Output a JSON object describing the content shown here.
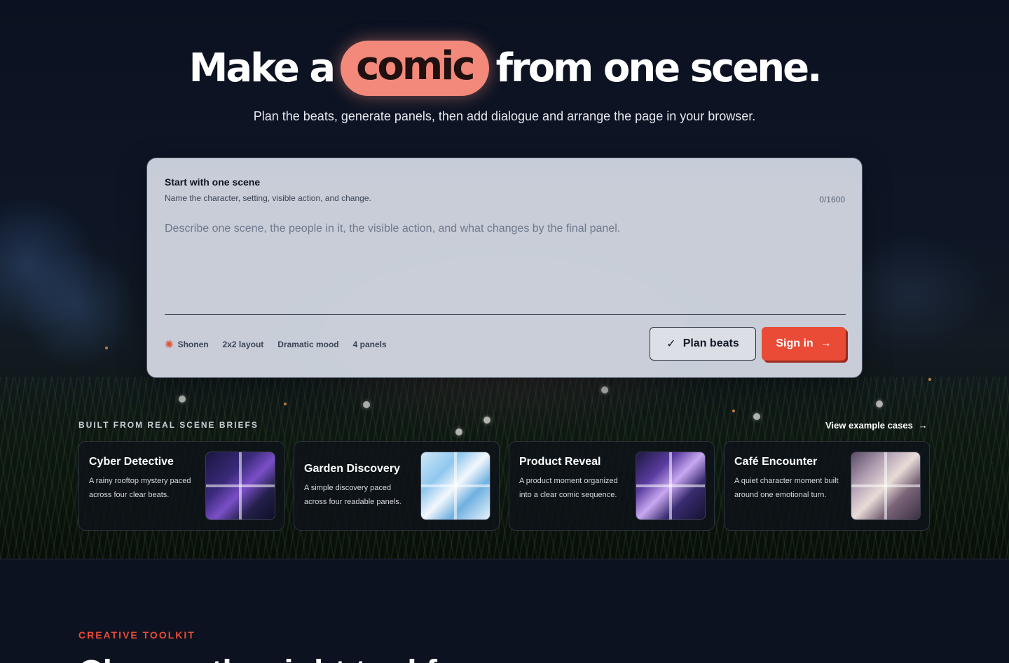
{
  "hero": {
    "headline_before": "Make a",
    "headline_highlight": "comic",
    "headline_after": "from one scene.",
    "subtitle": "Plan the beats, generate panels, then add dialogue and arrange the page in your browser."
  },
  "scene_card": {
    "title": "Start with one scene",
    "description": "Name the character, setting, visible action, and change.",
    "char_count": "0/1600",
    "placeholder": "Describe one scene, the people in it, the visible action, and what changes by the final panel.",
    "chips": [
      "Shonen",
      "2x2 layout",
      "Dramatic mood",
      "4 panels"
    ],
    "plan_button": "Plan beats",
    "signin_button": "Sign in"
  },
  "cases": {
    "label": "BUILT FROM REAL SCENE BRIEFS",
    "link": "View example cases",
    "items": [
      {
        "title": "Cyber Detective",
        "description": "A rainy rooftop mystery paced across four clear beats."
      },
      {
        "title": "Garden Discovery",
        "description": "A simple discovery paced across four readable panels."
      },
      {
        "title": "Product Reveal",
        "description": "A product moment organized into a clear comic sequence."
      },
      {
        "title": "Café Encounter",
        "description": "A quiet character moment built around one emotional turn."
      }
    ]
  },
  "toolkit": {
    "label": "CREATIVE TOOLKIT",
    "heading": "Choose the right tool for"
  },
  "colors": {
    "accent": "#ea4b36",
    "highlight_pill": "#f2897a",
    "background": "#0d1220"
  }
}
